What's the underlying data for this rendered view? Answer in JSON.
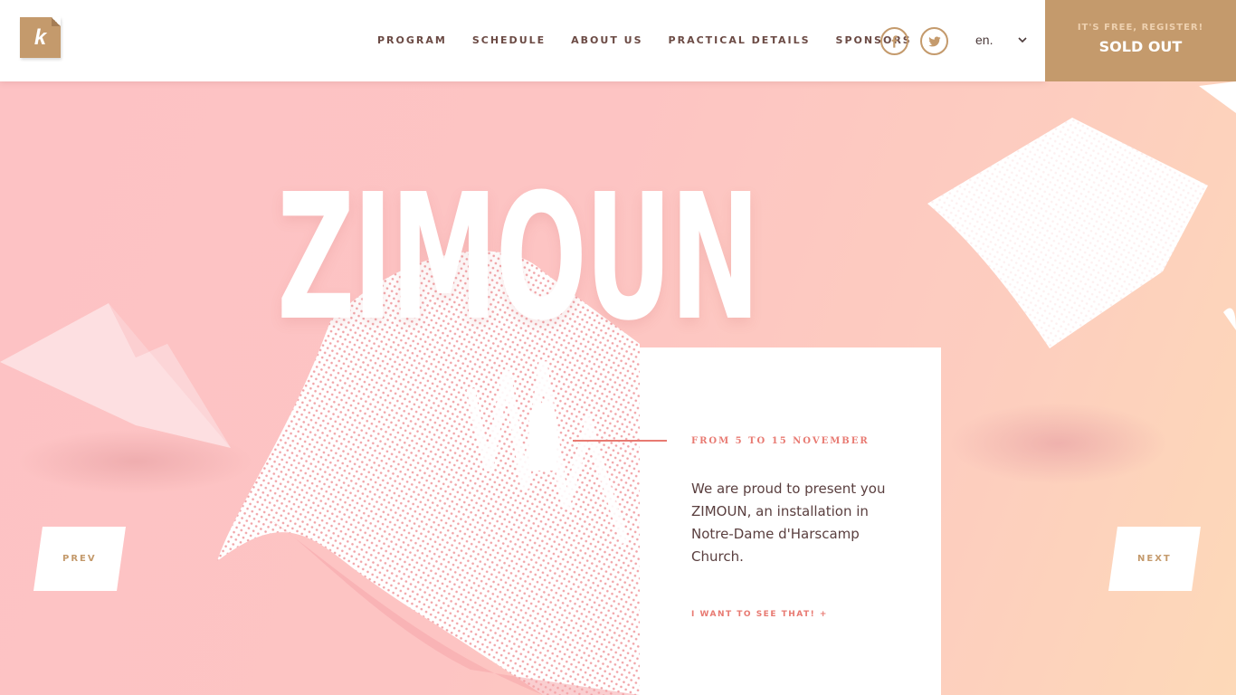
{
  "logo": {
    "glyph": "k"
  },
  "nav": {
    "items": [
      {
        "label": "PROGRAM"
      },
      {
        "label": "SCHEDULE"
      },
      {
        "label": "ABOUT US"
      },
      {
        "label": "PRACTICAL DETAILS"
      },
      {
        "label": "SPONSORS"
      }
    ]
  },
  "social": {
    "facebook_icon": "facebook-icon",
    "twitter_icon": "twitter-icon"
  },
  "language": {
    "selected": "en."
  },
  "register": {
    "subtitle": "IT'S FREE, REGISTER!",
    "title": "SOLD OUT"
  },
  "hero": {
    "title": "ZIMOUN"
  },
  "event": {
    "dates": "FROM 5 TO 15 NOVEMBER",
    "description": "We are proud to present you ZIMOUN, an installation in Notre-Dame d'Harscamp Church.",
    "cta": "I WANT TO SEE THAT! +"
  },
  "pager": {
    "prev": "PREV",
    "next": "NEXT"
  },
  "colors": {
    "accent": "#c49a6c",
    "coral": "#e87a72",
    "background": "#fdc2c4"
  }
}
